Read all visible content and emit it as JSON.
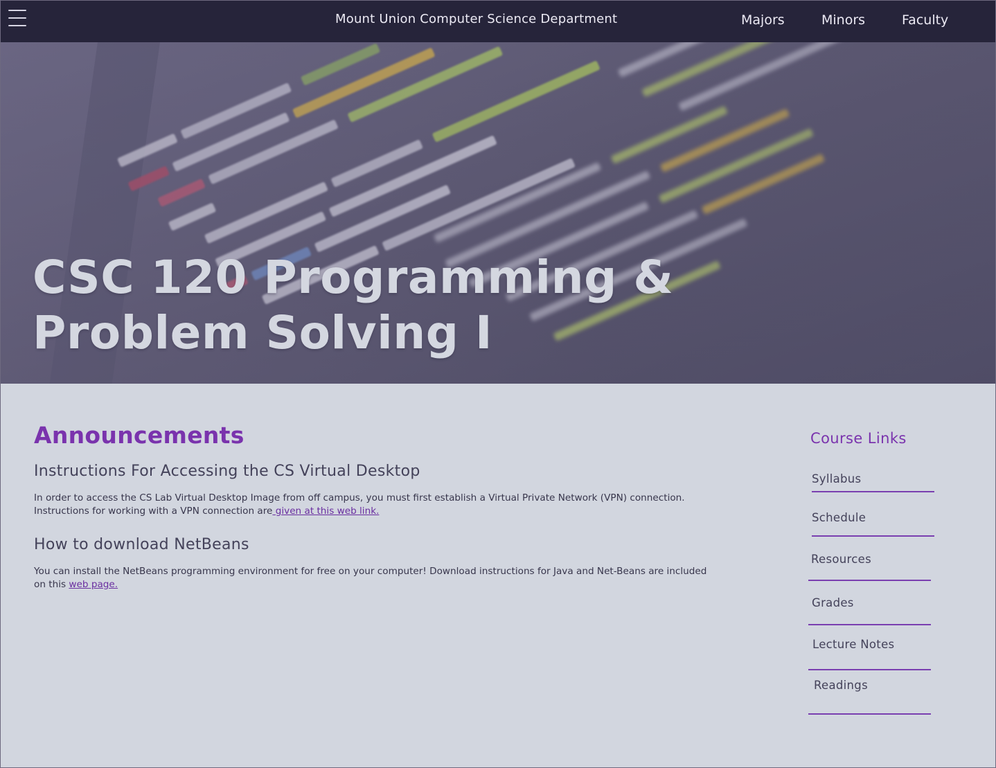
{
  "header": {
    "site_title": "Mount Union Computer Science Department",
    "nav": [
      "Majors",
      "Minors",
      "Faculty"
    ]
  },
  "hero": {
    "title_line1": "CSC 120 Programming &",
    "title_line2": "Problem Solving I"
  },
  "announcements": {
    "title": "Announcements",
    "items": [
      {
        "heading": "Instructions For Accessing the CS Virtual Desktop",
        "body": "In order to access the CS Lab Virtual Desktop Image from off campus, you must first establish a Virtual Private Network (VPN) connection. Instructions for working with a VPN connection are",
        "link": " given at this web link."
      },
      {
        "heading": "How to download NetBeans",
        "body": "You can install the NetBeans programming environment for free on your computer! Download instructions for Java and Net-Beans are included on this ",
        "link": "web page."
      }
    ]
  },
  "sidebar": {
    "title": "Course Links",
    "links": [
      "Syllabus",
      "Schedule",
      "Resources",
      "Grades",
      "Lecture Notes",
      "Readings"
    ]
  },
  "colors": {
    "topbar": "#26243a",
    "accent_purple": "#7a33ad",
    "page_bg": "#d2d6df"
  }
}
